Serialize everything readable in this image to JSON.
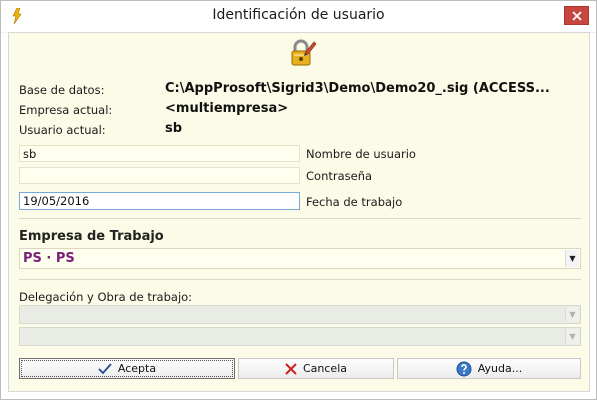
{
  "window": {
    "title": "Identificación de usuario",
    "close_glyph": "✕"
  },
  "info": {
    "database_label": "Base de datos:",
    "database_value": "C:\\AppProsoft\\Sigrid3\\Demo\\Demo20_.sig (ACCESS...",
    "company_label": "Empresa actual:",
    "company_value": "<multiempresa>",
    "user_label": "Usuario actual:",
    "user_value": "sb"
  },
  "form": {
    "username_value": "sb",
    "username_label": "Nombre de usuario",
    "password_value": "",
    "password_label": "Contraseña",
    "date_value": "19/05/2016",
    "date_label": "Fecha de trabajo"
  },
  "empresa": {
    "section_title": "Empresa de Trabajo",
    "selected": "PS · PS"
  },
  "delegacion": {
    "section_title": "Delegación y Obra de trabajo:"
  },
  "buttons": {
    "accept_label": "Acepta",
    "cancel_label": "Cancela",
    "help_label": "Ayuda..."
  },
  "icons": {
    "app": "lightning-app-icon",
    "header": "padlock-pencil-icon",
    "accept": "checkmark-icon",
    "cancel": "red-x-icon",
    "help": "help-question-icon"
  },
  "colors": {
    "client_bg": "#fbfbe7",
    "close_button": "#c7463f",
    "company_text": "#7b1e7a"
  }
}
